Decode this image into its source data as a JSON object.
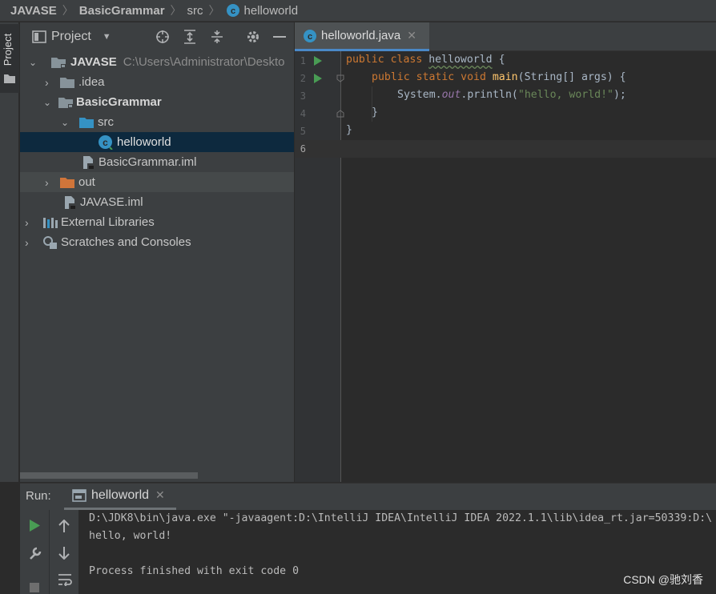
{
  "breadcrumb": {
    "items": [
      "JAVASE",
      "BasicGrammar",
      "src",
      "helloworld"
    ]
  },
  "left_strip": {
    "label": "Project"
  },
  "project_panel": {
    "title": "Project",
    "tree": [
      {
        "label": "JAVASE",
        "hint": "C:\\Users\\Administrator\\Deskto",
        "icon": "module-folder-icon",
        "expanded": true
      },
      {
        "label": ".idea",
        "icon": "folder-icon",
        "expanded": false
      },
      {
        "label": "BasicGrammar",
        "icon": "module-folder-icon",
        "expanded": true
      },
      {
        "label": "src",
        "icon": "source-folder-icon",
        "expanded": true
      },
      {
        "label": "helloworld",
        "icon": "java-class-icon",
        "selected": true
      },
      {
        "label": "BasicGrammar.iml",
        "icon": "iml-file-icon"
      },
      {
        "label": "out",
        "icon": "excluded-folder-icon",
        "expanded": false
      },
      {
        "label": "JAVASE.iml",
        "icon": "iml-file-icon"
      },
      {
        "label": "External Libraries",
        "icon": "library-icon",
        "expanded": false
      },
      {
        "label": "Scratches and Consoles",
        "icon": "scratches-icon",
        "expanded": false
      }
    ]
  },
  "editor": {
    "tab_label": "helloworld.java",
    "line_numbers": [
      "1",
      "2",
      "3",
      "4",
      "5",
      "6"
    ],
    "code": {
      "l1_kw": "public class ",
      "l1_name": "helloworld",
      "l1_rest": " {",
      "l2_kw": "public static void ",
      "l2_fn": "main",
      "l2_rest": "(String[] args) {",
      "l3_a": "System.",
      "l3_field": "out",
      "l3_b": ".println(",
      "l3_str": "\"hello, world!\"",
      "l3_c": ");",
      "l4": "}",
      "l5": "}"
    }
  },
  "run_panel": {
    "label": "Run:",
    "tab_label": "helloworld",
    "console": [
      "D:\\JDK8\\bin\\java.exe \"-javaagent:D:\\IntelliJ IDEA\\IntelliJ IDEA 2022.1.1\\lib\\idea_rt.jar=50339:D:\\",
      "hello, world!",
      "",
      "Process finished with exit code 0"
    ]
  },
  "watermark": "CSDN @驰刘香",
  "colors": {
    "accent": "#4a88c7",
    "run_green": "#499c54",
    "selection": "#0d293e"
  }
}
